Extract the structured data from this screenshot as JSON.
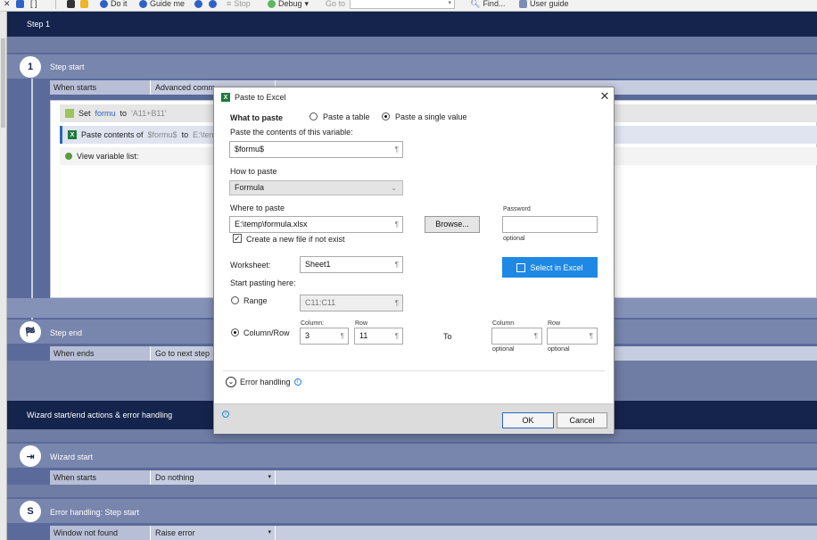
{
  "toolbar": {
    "doit": "Do it",
    "guide_me": "Guide me",
    "stop": "Stop",
    "debug": "Debug",
    "go_to": "Go to",
    "find": "Find...",
    "user_guide": "User guide"
  },
  "step1": {
    "header": "Step 1",
    "number": "1",
    "start_label": "Step start",
    "when_starts": "When starts",
    "advanced": "Advanced comm",
    "actions": [
      {
        "prefix": "Set",
        "var": "formu",
        "middle": "to",
        "value": "'A11+B11'"
      },
      {
        "prefix": "Paste contents of",
        "var": "$formu$",
        "middle": "to",
        "value": "E:\\tem"
      },
      {
        "prefix": "View variable list:"
      }
    ],
    "end_label": "Step end",
    "when_ends": "When ends",
    "go_next": "Go to next step"
  },
  "wizard": {
    "header": "Wizard start/end actions & error handling",
    "start_label": "Wizard start",
    "when_starts": "When starts",
    "do_nothing": "Do nothing",
    "s_letter": "S",
    "error_label": "Error handling: Step start",
    "window_not_found": "Window not found",
    "raise_error": "Raise error"
  },
  "dialog": {
    "title": "Paste to Excel",
    "what_to_paste": "What to paste",
    "paste_table": "Paste a table",
    "paste_single": "Paste a single value",
    "paste_contents_label": "Paste the contents of this variable:",
    "variable_value": "$formu$",
    "how_to_paste": "How to paste",
    "how_value": "Formula",
    "where_to_paste": "Where to paste",
    "path_value": "E:\\temp\\formula.xlsx",
    "browse": "Browse...",
    "password_label": "Password",
    "password_optional": "optional",
    "create_new": "Create a new file if not exist",
    "worksheet_label": "Worksheet:",
    "worksheet_value": "Sheet1",
    "select_in_excel": "Select in Excel",
    "start_pasting": "Start pasting here:",
    "range_label": "Range",
    "range_value": "C11:C11",
    "colrow_label": "Column/Row",
    "column_head": "Column:",
    "row_head": "Row",
    "column_value": "3",
    "row_value": "11",
    "to_label": "To",
    "to_column_head": "Column",
    "to_row_head": "Row",
    "optional1": "optional",
    "optional2": "optional",
    "error_handling": "Error handling",
    "ok": "OK",
    "cancel": "Cancel"
  },
  "colors": {
    "dark_bar": "#15244d",
    "accent_blue": "#1e88e5",
    "excel_green": "#1e7a3c"
  }
}
